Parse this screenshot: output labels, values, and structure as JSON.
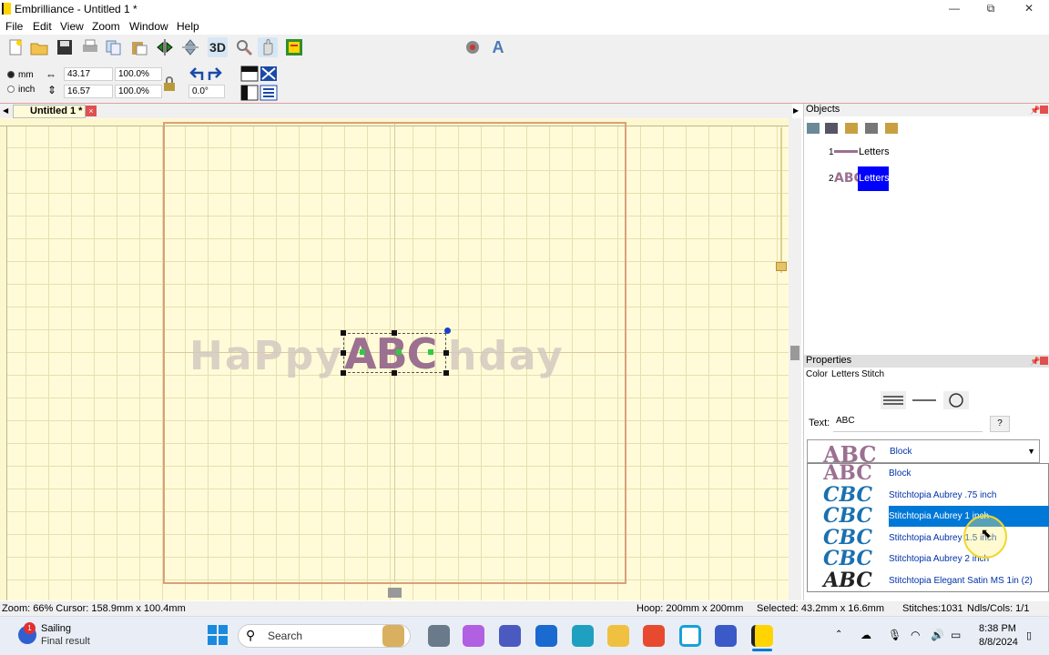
{
  "window": {
    "title": "Embrilliance - Untitled 1 *"
  },
  "menu": [
    "File",
    "Edit",
    "View",
    "Zoom",
    "Window",
    "Help"
  ],
  "toolbar": {
    "btn_3d": "3D"
  },
  "measure": {
    "unit_mm": "mm",
    "unit_inch": "inch",
    "width": "43.17",
    "height": "16.57",
    "width_pct": "100.0%",
    "height_pct": "100.0%",
    "rotation": "0.0°"
  },
  "tab": {
    "label": "Untitled 1 *"
  },
  "canvas": {
    "ghost_left": "HaPpy",
    "ghost_right": "hday",
    "selected_text": "ABC"
  },
  "objects": {
    "title": "Objects",
    "items": [
      {
        "num": "1",
        "label": "Letters"
      },
      {
        "num": "2",
        "label": "Letters"
      }
    ]
  },
  "properties": {
    "title": "Properties",
    "tabs": [
      "Color",
      "Letters",
      "Stitch"
    ],
    "text_label": "Text:",
    "text_value": "ABC",
    "help_button": "?",
    "selected_font": "Block",
    "preview_block": "ABC",
    "preview_script": "CBC",
    "fonts": [
      "Block",
      "Stitchtopia Aubrey .75 inch",
      "Stitchtopia Aubrey 1 inch",
      "Stitchtopia Aubrey 1.5 inch",
      "Stitchtopia Aubrey 2 inch",
      "Stitchtopia Elegant Satin MS 1in (2)"
    ]
  },
  "status": {
    "zoom": "Zoom: 66%  Cursor: 158.9mm x 100.4mm",
    "hoop": "Hoop: 200mm x 200mm",
    "selected": "Selected: 43.2mm x 16.6mm",
    "stitches": "Stitches:1031",
    "ndls": "Ndls/Cols: 1/1"
  },
  "taskbar": {
    "weather_title": "Sailing",
    "weather_sub": "Final result",
    "search": "Search",
    "time": "8:38 PM",
    "date": "8/8/2024",
    "badge": "1"
  },
  "colors": {
    "accent": "#0078d7",
    "letters": "#9b7090",
    "canvas": "#fffbd8",
    "selection": "#0000ff"
  }
}
